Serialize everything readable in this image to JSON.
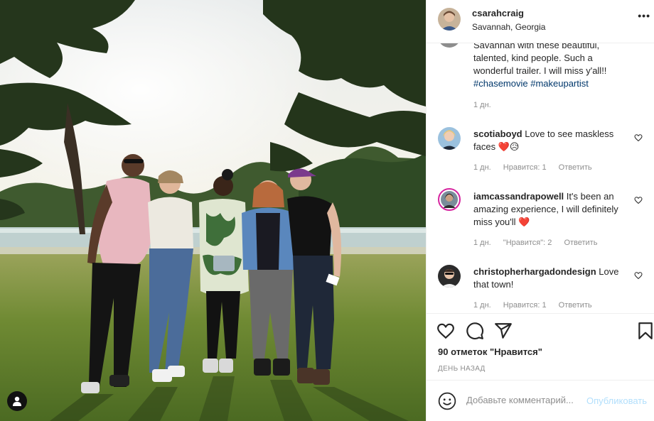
{
  "post": {
    "author": "csarahcraig",
    "location": "Savannah, Georgia",
    "more_icon": "more-horizontal-icon",
    "caption_lines": [
      "Savannah with these beautiful,",
      "talented, kind people. Such a",
      "wonderful trailer. I will miss y'all!!"
    ],
    "caption_tags": "#chasemovie #makeupartist",
    "caption_time": "1 дн."
  },
  "comments": [
    {
      "user": "scotiaboyd",
      "text": "Love to see maskless faces",
      "emoji": "❤️😥",
      "time": "1 дн.",
      "likes": "Нравится: 1",
      "reply": "Ответить"
    },
    {
      "user": "iamcassandrapowell",
      "text": "It's been an amazing experience, I will definitely miss you'll",
      "emoji": "❤️",
      "time": "1 дн.",
      "likes": "\"Нравится\": 2",
      "reply": "Ответить"
    },
    {
      "user": "christopherhargadondesign",
      "text": "Love that town!",
      "emoji": "",
      "time": "1 дн.",
      "likes": "Нравится: 1",
      "reply": "Ответить"
    }
  ],
  "actions": {
    "likes_count": "90 отметок \"Нравится\"",
    "posted_ago": "ДЕНЬ НАЗАД",
    "icons": [
      "heart-icon",
      "comment-icon",
      "share-icon",
      "bookmark-icon"
    ]
  },
  "add_comment": {
    "placeholder": "Добавьте комментарий...",
    "publish_label": "Опубликовать",
    "emoji_icon": "smiley-icon"
  },
  "colors": {
    "link": "#00376b",
    "secondary_text": "#8e8e8e",
    "publish_disabled": "#b2dffc",
    "heart_red": "#ed4956"
  }
}
